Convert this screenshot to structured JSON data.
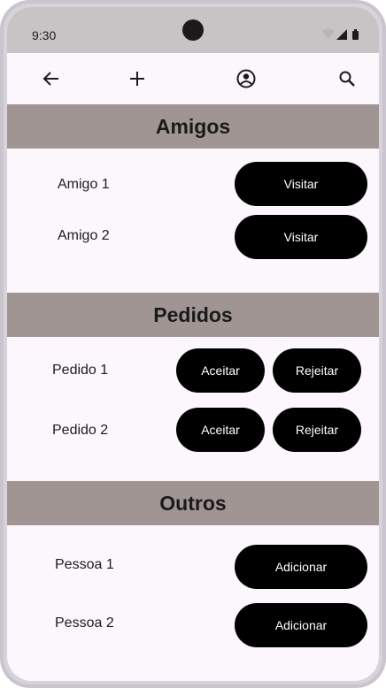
{
  "status": {
    "time": "9:30"
  },
  "appbar": {
    "back_icon": "arrow-back-icon",
    "add_icon": "plus-icon",
    "profile_icon": "account-circle-icon",
    "search_icon": "search-icon"
  },
  "sections": {
    "friends": {
      "title": "Amigos",
      "items": [
        {
          "label": "Amigo 1",
          "action": "Visitar"
        },
        {
          "label": "Amigo 2",
          "action": "Visitar"
        }
      ]
    },
    "requests": {
      "title": "Pedidos",
      "items": [
        {
          "label": "Pedido 1",
          "accept": "Aceitar",
          "reject": "Rejeitar"
        },
        {
          "label": "Pedido 2",
          "accept": "Aceitar",
          "reject": "Rejeitar"
        }
      ]
    },
    "others": {
      "title": "Outros",
      "items": [
        {
          "label": "Pessoa 1",
          "action": "Adicionar"
        },
        {
          "label": "Pessoa 2",
          "action": "Adicionar"
        }
      ]
    }
  },
  "colors": {
    "header_bg": "#a09593",
    "content_bg": "#fcf6fd",
    "button_bg": "#000000",
    "statusbar_bg": "#c8c3c5"
  }
}
